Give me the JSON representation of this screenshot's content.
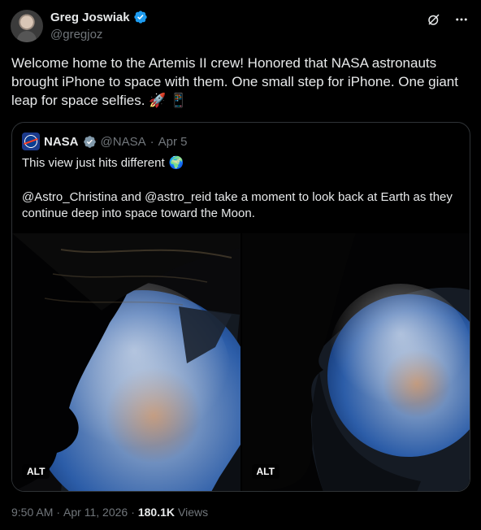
{
  "author": {
    "name": "Greg Joswiak",
    "handle": "@gregjoz",
    "verified": true
  },
  "tweet": {
    "text": "Welcome home to the Artemis II crew! Honored that NASA astronauts brought iPhone to space with them. One small step for iPhone. One giant leap for space selfies. 🚀 📱"
  },
  "quote": {
    "name": "NASA",
    "handle": "@NASA",
    "separator": "·",
    "date": "Apr 5",
    "line1": "This view just hits different",
    "line1_emoji": "🌍",
    "line2": "@Astro_Christina and @astro_reid take a moment to look back at Earth as they continue deep into space toward the Moon.",
    "images": [
      {
        "alt_label": "ALT"
      },
      {
        "alt_label": "ALT"
      }
    ]
  },
  "footer": {
    "time": "9:50 AM",
    "sep1": "·",
    "date": "Apr 11, 2026",
    "sep2": "·",
    "views_count": "180.1K",
    "views_label": "Views"
  },
  "colors": {
    "background": "#000000",
    "text": "#e7e9ea",
    "muted": "#71767b",
    "border": "#2f3336",
    "verified_blue": "#1d9bf0",
    "verified_gray": "#829aab"
  },
  "icons": [
    "grok-icon",
    "more-icon",
    "verified-icon"
  ]
}
